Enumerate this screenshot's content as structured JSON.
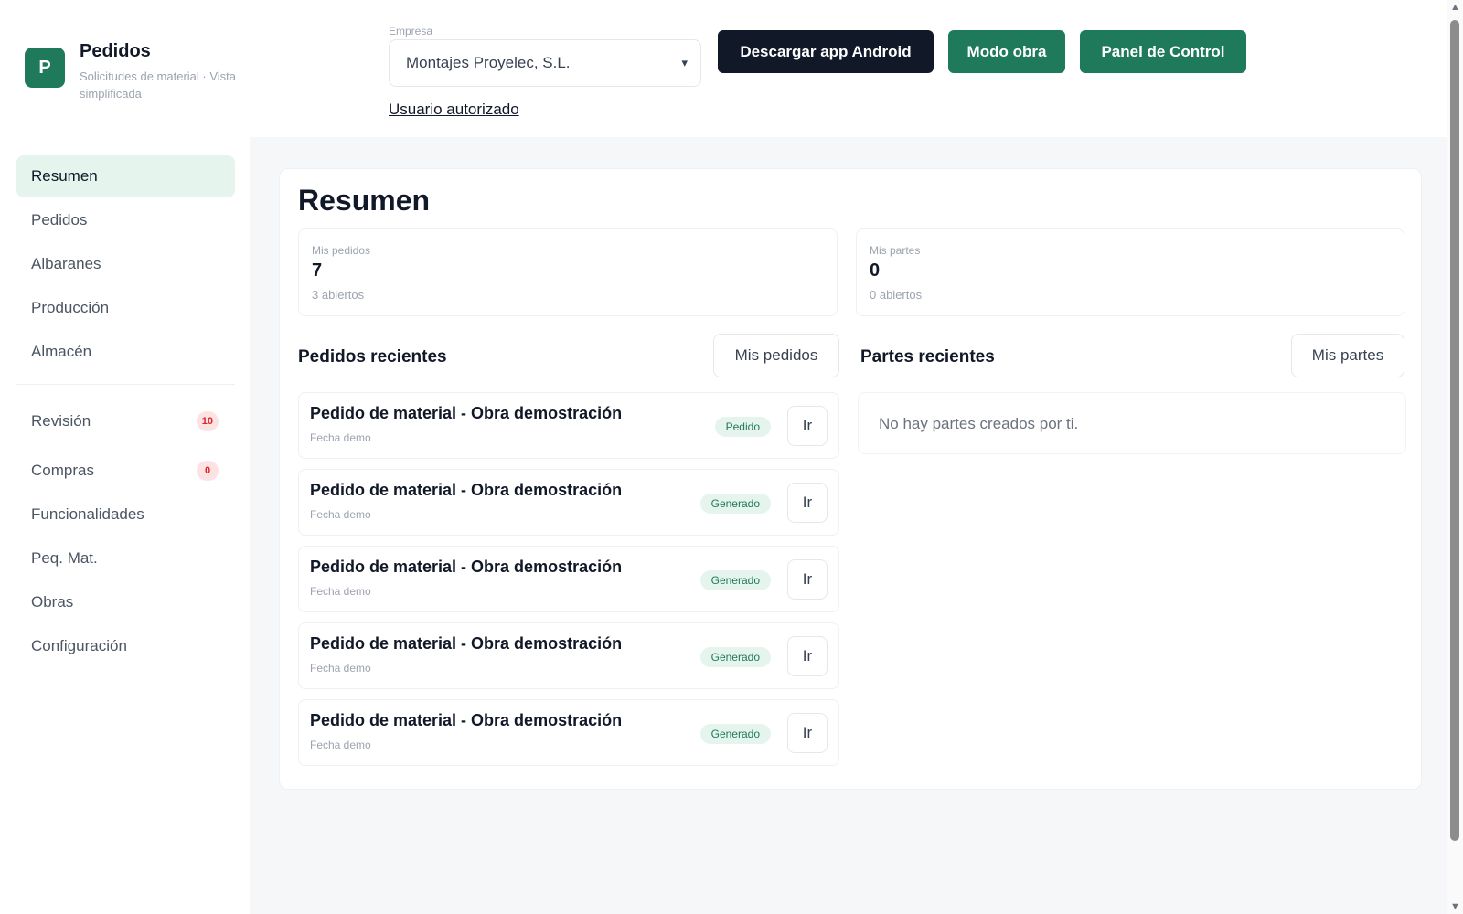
{
  "header": {
    "logo_letter": "P",
    "title": "Pedidos",
    "subtitle": "Solicitudes de material · Vista simplificada",
    "company_label": "Empresa",
    "company_value": "Montajes Proyelec, S.L.",
    "user_link": "Usuario autorizado",
    "buttons": {
      "android": "Descargar app Android",
      "modo_obra": "Modo obra",
      "panel": "Panel de Control"
    }
  },
  "sidebar": {
    "items": [
      {
        "label": "Resumen"
      },
      {
        "label": "Pedidos"
      },
      {
        "label": "Albaranes"
      },
      {
        "label": "Producción"
      },
      {
        "label": "Almacén"
      },
      {
        "label": "Revisión",
        "badge": "10"
      },
      {
        "label": "Compras",
        "badge": "0"
      },
      {
        "label": "Funcionalidades"
      },
      {
        "label": "Peq. Mat."
      },
      {
        "label": "Obras"
      },
      {
        "label": "Configuración"
      }
    ]
  },
  "main": {
    "title": "Resumen",
    "stats": {
      "pedidos": {
        "label": "Mis pedidos",
        "value": "7",
        "sub": "3 abiertos"
      },
      "partes": {
        "label": "Mis partes",
        "value": "0",
        "sub": "0 abiertos"
      }
    },
    "recent_orders": {
      "title": "Pedidos recientes",
      "button": "Mis pedidos",
      "go_label": "Ir",
      "rows": [
        {
          "title": "Pedido de material - Obra demostración",
          "date": "Fecha demo",
          "status": "Pedido"
        },
        {
          "title": "Pedido de material - Obra demostración",
          "date": "Fecha demo",
          "status": "Generado"
        },
        {
          "title": "Pedido de material - Obra demostración",
          "date": "Fecha demo",
          "status": "Generado"
        },
        {
          "title": "Pedido de material - Obra demostración",
          "date": "Fecha demo",
          "status": "Generado"
        },
        {
          "title": "Pedido de material - Obra demostración",
          "date": "Fecha demo",
          "status": "Generado"
        }
      ]
    },
    "recent_parts": {
      "title": "Partes recientes",
      "button": "Mis partes",
      "empty": "No hay partes creados por ti."
    }
  },
  "icons": {
    "select_chevron": "chevron-down-icon",
    "scroll_up": "triangle-up-icon",
    "scroll_down": "triangle-down-icon"
  },
  "colors": {
    "brand": "#1f7a5c",
    "dark_button": "#111827",
    "active_nav": "#e6f4ee",
    "badge_text": "#dc2626"
  }
}
